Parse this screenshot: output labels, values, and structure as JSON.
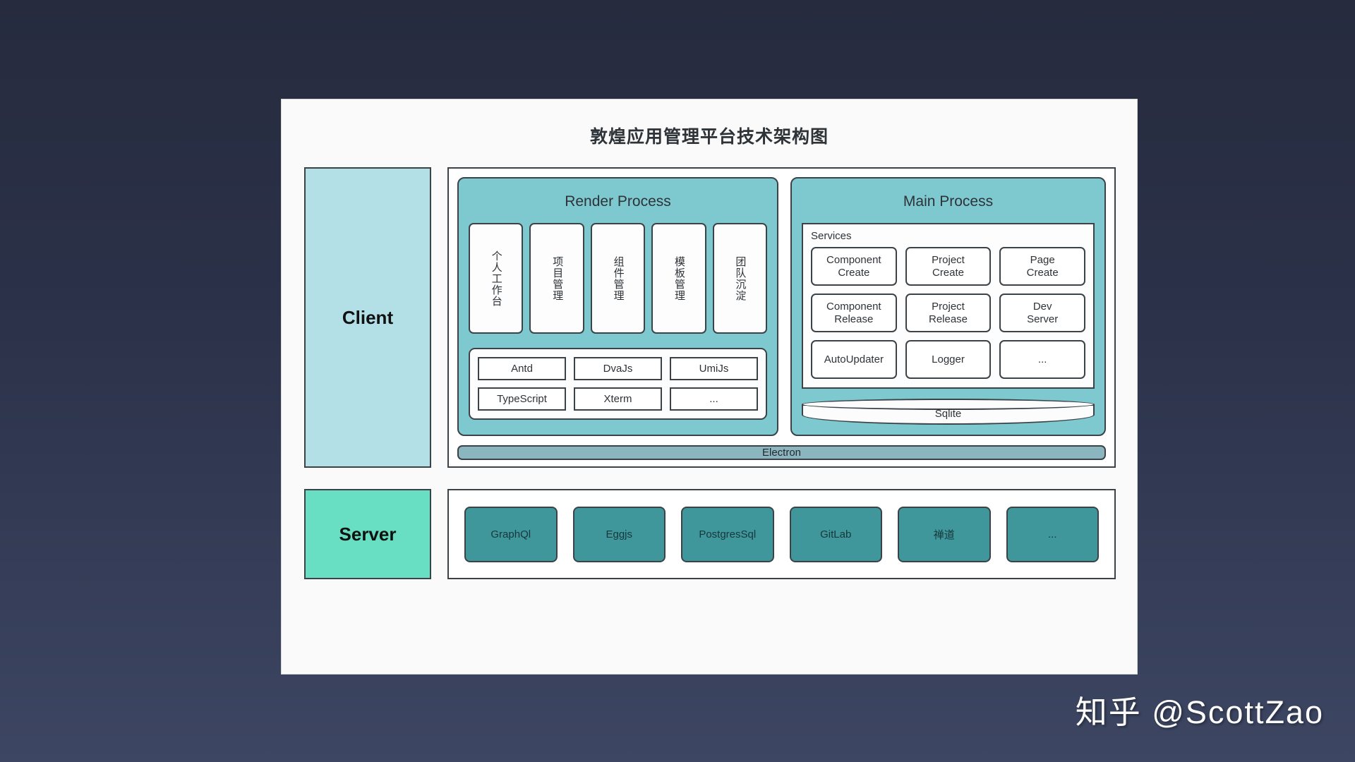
{
  "canvas": {
    "background_top": "#262b3e",
    "background_bottom": "#3d4662"
  },
  "card": {
    "title": "敦煌应用管理平台技术架构图",
    "background": "#fafafa"
  },
  "client_row": {
    "badge_label": "Client",
    "badge_color": "#b2e0e6",
    "render_process": {
      "title": "Render Process",
      "panel_color": "#7ec9d0",
      "modules": [
        "个人工作台",
        "项目管理",
        "组件管理",
        "模板管理",
        "团队沉淀"
      ],
      "stack_row_1": [
        "Antd",
        "DvaJs",
        "UmiJs"
      ],
      "stack_row_2": [
        "TypeScript",
        "Xterm",
        "..."
      ]
    },
    "main_process": {
      "title": "Main Process",
      "panel_color": "#7ec9d0",
      "services_label": "Services",
      "services_row_1": [
        "Component\nCreate",
        "Project\nCreate",
        "Page\nCreate"
      ],
      "services_row_2": [
        "Component\nRelease",
        "Project\nRelease",
        "Dev\nServer"
      ],
      "services_row_3": [
        "AutoUpdater",
        "Logger",
        "..."
      ],
      "database_label": "Sqlite"
    },
    "platform_label": "Electron",
    "platform_color": "#8cb6bf"
  },
  "server_row": {
    "badge_label": "Server",
    "badge_color": "#68dfc2",
    "tile_color": "#3f969b",
    "tiles": [
      "GraphQl",
      "Eggjs",
      "PostgresSql",
      "GitLab",
      "禅道",
      "..."
    ]
  },
  "watermark": {
    "text": "知乎 @ScottZao"
  }
}
